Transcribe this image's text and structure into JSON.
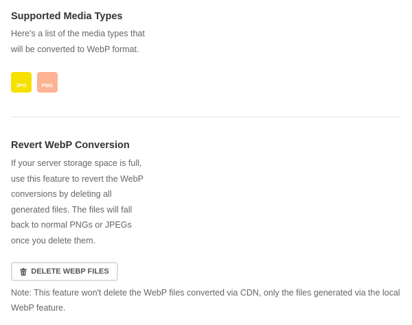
{
  "supported": {
    "title": "Supported Media Types",
    "description_lines": [
      "Here's a list of the media types that",
      "will be converted to WebP format."
    ],
    "media_types": [
      {
        "label": "JPG",
        "color": "#f6e000"
      },
      {
        "label": "PNG",
        "color": "#fdb394"
      }
    ]
  },
  "revert": {
    "title": "Revert WebP Conversion",
    "description_lines": [
      "If your server storage space is full,",
      "use this feature to revert the WebP",
      "conversions by deleting all",
      "generated files. The files will fall",
      "back to normal PNGs or JPEGs",
      "once you delete them."
    ],
    "button_label": "DELETE WEBP FILES",
    "button_icon": "trash-icon",
    "note_lines": [
      "Note: This feature won't delete the WebP files converted via CDN, only the files generated via the local",
      "WebP feature."
    ]
  }
}
